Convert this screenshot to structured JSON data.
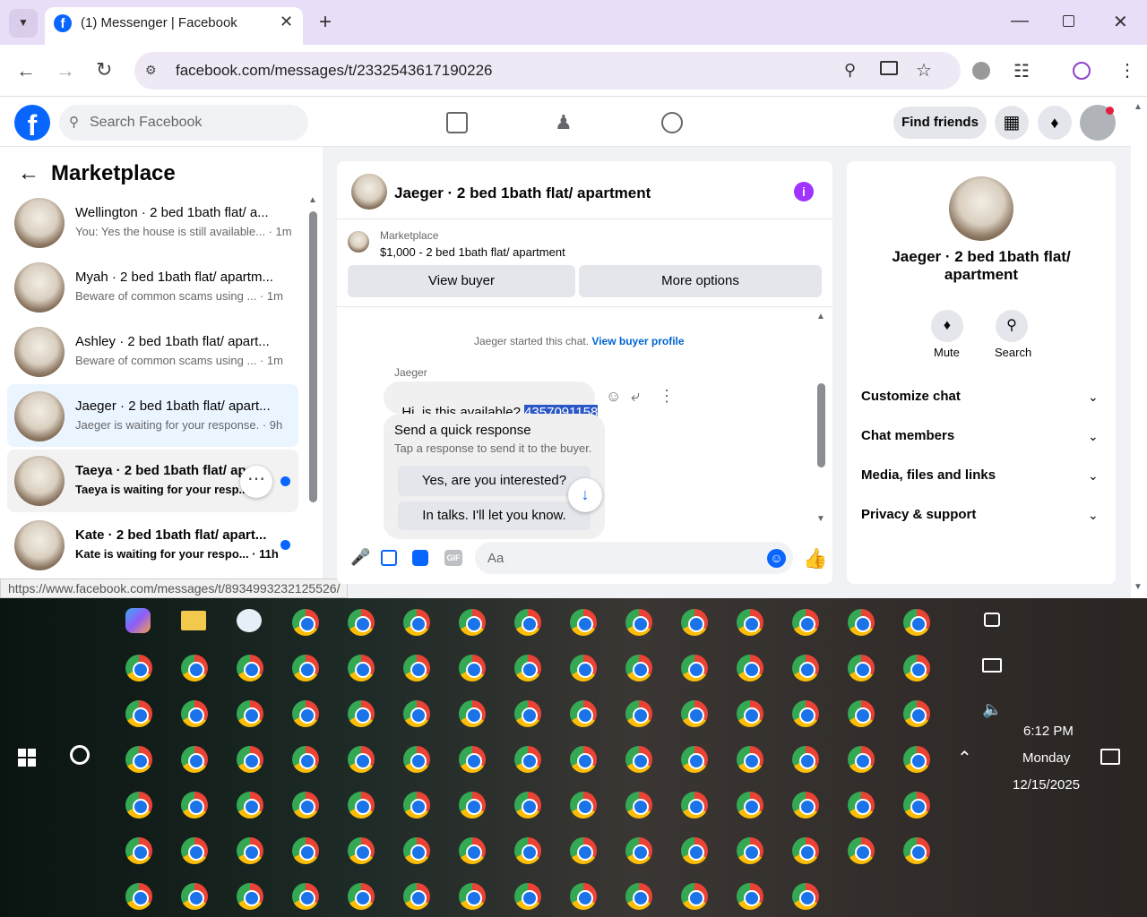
{
  "browser": {
    "tab_title": "(1) Messenger | Facebook",
    "url": "facebook.com/messages/t/2332543617190226",
    "status_url": "https://www.facebook.com/messages/t/8934993232125526/"
  },
  "fb": {
    "search_placeholder": "Search Facebook",
    "find_friends": "Find friends"
  },
  "left": {
    "title": "Marketplace",
    "conversations": [
      {
        "name": "Wellington · 2 bed 1bath flat/ a...",
        "preview": "You: Yes the house is still available... · 1m",
        "unread": false
      },
      {
        "name": "Myah · 2 bed 1bath flat/ apartm...",
        "preview": "Beware of common scams using ... · 1m",
        "unread": false
      },
      {
        "name": "Ashley · 2 bed 1bath flat/ apart...",
        "preview": "Beware of common scams using ... · 1m",
        "unread": false
      },
      {
        "name": "Jaeger · 2 bed 1bath flat/ apart...",
        "preview": "Jaeger is waiting for your response. · 9h",
        "unread": false
      },
      {
        "name": "Taeya · 2 bed 1bath flat/ apa",
        "preview": "Taeya is waiting for your resp...",
        "unread": true
      },
      {
        "name": "Kate · 2 bed 1bath flat/ apart...",
        "preview": "Kate is waiting for your respo... · 11h",
        "unread": true
      }
    ]
  },
  "chat": {
    "title": "Jaeger · 2 bed 1bath flat/ apartment",
    "listing_source": "Marketplace",
    "listing_line": "$1,000 - 2 bed 1bath flat/ apartment",
    "view_buyer": "View buyer",
    "more_options": "More options",
    "started_text": "Jaeger started this chat.",
    "view_buyer_profile": "View buyer profile",
    "sender": "Jaeger",
    "message_text": "Hi, is this available? ",
    "message_number": "4357091158",
    "quick_title": "Send a quick response",
    "quick_sub": "Tap a response to send it to the buyer.",
    "quick_1": "Yes, are you interested?",
    "quick_2": "In talks. I'll let you know.",
    "input_placeholder": "Aa"
  },
  "info": {
    "title": "Jaeger · 2 bed 1bath flat/ apartment",
    "mute": "Mute",
    "search": "Search",
    "menu": [
      "Customize chat",
      "Chat members",
      "Media, files and links",
      "Privacy & support"
    ]
  },
  "taskbar": {
    "time": "6:12 PM",
    "day": "Monday",
    "date": "12/15/2025"
  }
}
